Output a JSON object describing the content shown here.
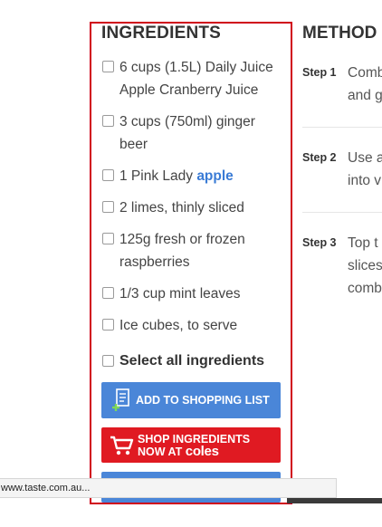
{
  "ingredients": {
    "title": "INGREDIENTS",
    "items": [
      {
        "line1": "6 cups (1.5L) Daily Juice",
        "line2": "Apple Cranberry Juice"
      },
      {
        "line1": "3 cups (750ml) ginger",
        "line2": "beer"
      },
      {
        "text": "1 Pink Lady ",
        "link": "apple"
      },
      {
        "text": "2 limes, thinly sliced"
      },
      {
        "line1": "125g fresh or frozen",
        "line2": "raspberries"
      },
      {
        "text": "1/3 cup mint leaves"
      },
      {
        "text": "Ice cubes, to serve"
      }
    ],
    "select_all": "Select all ingredients",
    "add_to_shopping_list": "ADD TO SHOPPING LIST",
    "shop_coles_line1": "SHOP INGREDIENTS",
    "shop_coles_line2": "NOW AT",
    "coles_logo": "coles"
  },
  "method": {
    "title": "METHOD",
    "steps": [
      {
        "label": "Step 1",
        "line1": "Comb",
        "line2": "and g"
      },
      {
        "label": "Step 2",
        "line1": "Use a",
        "line2": "into v"
      },
      {
        "label": "Step 3",
        "line1": "Top t",
        "line2": "slices",
        "line3": "comb"
      }
    ]
  },
  "status_bar": {
    "url": "www.taste.com.au..."
  },
  "colors": {
    "highlight_border": "#d0021b",
    "primary_blue": "#4a86d8",
    "coles_red": "#e01a22",
    "link_blue": "#3a7bd5"
  }
}
